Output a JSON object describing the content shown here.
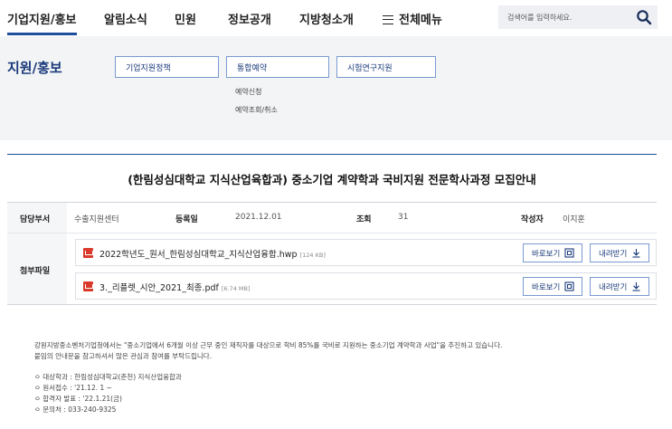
{
  "nav": {
    "items": [
      "기업지원/홍보",
      "알림소식",
      "민원",
      "정보공개",
      "지방청소개"
    ],
    "all_menu": "전체메뉴",
    "search_placeholder": "검색어를 입력하세요."
  },
  "sub": {
    "title": "지원/홍보",
    "buttons": [
      "기업지원정책",
      "통합예약",
      "시험연구지원"
    ],
    "links": [
      "예약신청",
      "예약조회/취소"
    ]
  },
  "post": {
    "title": "(한림성심대학교 지식산업육합과) 중소기업 계약학과 국비지원 전문학사과정 모집안내",
    "dept_label": "담당부서",
    "dept": "수출지원센터",
    "date_label": "등록일",
    "date": "2021.12.01",
    "views_label": "조회",
    "views": "31",
    "author_label": "작성자",
    "author": "이지훈",
    "attach_label": "첨부파일"
  },
  "files": [
    {
      "name": "2022학년도_원서_한림성심대학교_지식산업융합.hwp",
      "size": "[124 KB]"
    },
    {
      "name": "3._리플렛_시안_2021_최종.pdf",
      "size": "[6.74 MB]"
    }
  ],
  "file_buttons": {
    "view": "바로보기",
    "download": "내려받기"
  },
  "body": {
    "para1": "강원지방중소벤처기업청에서는 \"중소기업에서 6개월 이상 근무 중인 재직자를 대상으로 학비 85%를 국비로 지원하는 중소기업 계약학과 사업\"을 추진하고 있습니다.",
    "para2": "붙임의 안내문을 참고하셔서 많은 관심과 참여를 부탁드립니다.",
    "bullets": [
      "ㅇ 대상학과 : 한림성심대학교(춘천) 지식산업융합과",
      "ㅇ 원서접수 : '21.12. 1 ~",
      "ㅇ 합격자 발표 : '22.1.21(금)",
      "ㅇ 문의처 : 033-240-9325"
    ]
  }
}
